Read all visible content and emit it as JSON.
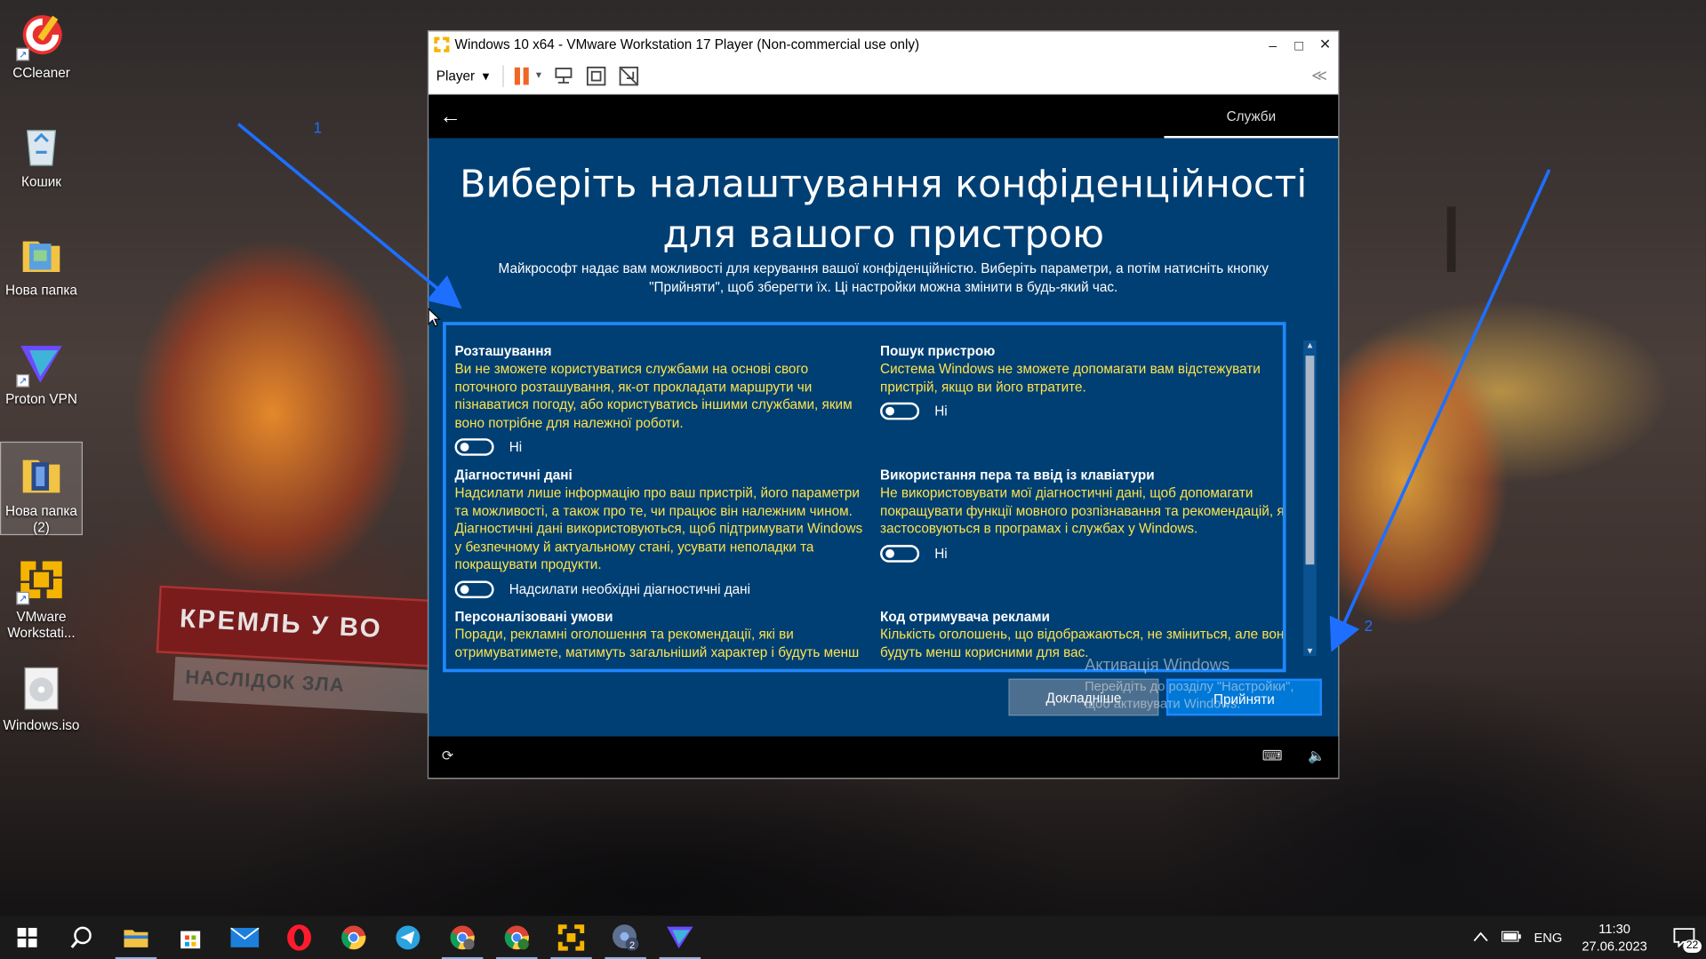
{
  "desktop": {
    "icons": [
      {
        "label": "CCleaner",
        "icon": "ccleaner-icon"
      },
      {
        "label": "Кошик",
        "icon": "recycle-bin-icon"
      },
      {
        "label": "Нова папка",
        "icon": "folder-icon"
      },
      {
        "label": "Proton VPN",
        "icon": "proton-vpn-icon"
      },
      {
        "label": "Нова папка (2)",
        "icon": "folder-icon"
      },
      {
        "label": "VMware Workstati...",
        "icon": "vmware-icon"
      },
      {
        "label": "Windows.iso",
        "icon": "disc-image-icon"
      }
    ],
    "wallpaper_text_1": "КРЕМЛЬ У ВО",
    "wallpaper_text_2": "НАСЛІДОК ЗЛА"
  },
  "vmware": {
    "title": "Windows 10 x64 - VMware Workstation 17 Player (Non-commercial use only)",
    "player_menu": "Player",
    "window_controls": {
      "minimize": "–",
      "maximize": "□",
      "close": "✕"
    },
    "collapse_symbol": "≪"
  },
  "guest": {
    "back_symbol": "←",
    "top_tab": "Служби",
    "title": "Виберіть налаштування конфіденційності для вашого пристрою",
    "subtitle": "Майкрософт надає вам можливості для керування вашої конфіденційністю. Виберіть параметри, а потім натисніть кнопку \"Прийняти\", щоб зберегти їх. Ці настройки можна змінити в будь-який час.",
    "settings": {
      "location": {
        "title": "Розташування",
        "desc": "Ви не зможете користуватися службами на основі свого поточного розташування, як-от прокладати маршрути чи пізнаватися погоду, або користуватись іншими службами, яким воно потрібне для належної роботи.",
        "toggle_label": "Ні"
      },
      "find_device": {
        "title": "Пошук пристрою",
        "desc": "Система Windows не зможете допомагати вам відстежувати пристрій, якщо ви його втратите.",
        "toggle_label": "Ні"
      },
      "diagnostics": {
        "title": "Діагностичні дані",
        "desc": "Надсилати лише інформацію про ваш пристрій, його параметри та можливості, а також про те, чи працює він належним чином. Діагностичні дані використовуються, щоб підтримувати Windows у безпечному й актуальному стані, усувати неполадки та покращувати продукти.",
        "toggle_label": "Надсилати необхідні діагностичні дані"
      },
      "inking": {
        "title": "Використання пера та ввід із клавіатури",
        "desc": "Не використовувати мої діагностичні дані, щоб допомагати покращувати функції мовного розпізнавання та рекомендацій, як застосовуються в програмах і службах у Windows.",
        "toggle_label": "Ні"
      },
      "tailored": {
        "title": "Персоналізовані умови",
        "desc": "Поради, рекламні оголошення та рекомендації, які ви отримуватимете, матимуть загальніший характер і будуть менш"
      },
      "ads": {
        "title": "Код отримувача реклами",
        "desc": "Кількість оголошень, що відображаються, не зміниться, але вони будуть менш корисними для вас."
      }
    },
    "buttons": {
      "more": "Докладніше",
      "accept": "Прийняти"
    },
    "activation": {
      "title": "Активація Windows",
      "line1": "Перейдіть до розділу \"Настройки\",",
      "line2": "щоб активувати Windows."
    }
  },
  "annotations": {
    "arrow1": "1",
    "arrow2": "2",
    "color": "#1e6fff"
  },
  "taskbar": {
    "apps": [
      "start-icon",
      "search-icon",
      "file-explorer-icon",
      "microsoft-store-icon",
      "mail-icon",
      "opera-icon",
      "chrome-icon",
      "telegram-icon",
      "chrome-c-icon",
      "chrome-j-icon",
      "vmware-icon",
      "chrome-2-icon",
      "proton-vpn-icon"
    ],
    "language": "ENG",
    "time": "11:30",
    "date": "27.06.2023",
    "notifications": "22"
  }
}
